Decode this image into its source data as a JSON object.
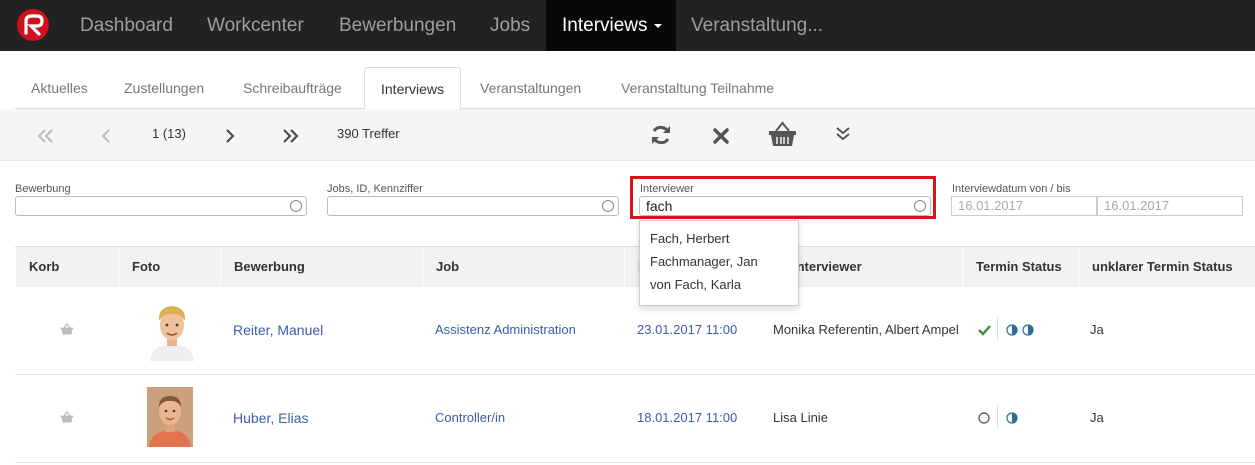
{
  "navbar": {
    "items": [
      "Dashboard",
      "Workcenter",
      "Bewerbungen",
      "Jobs",
      "Interviews",
      "Veranstaltung..."
    ],
    "active": "Interviews"
  },
  "tabs": [
    "Aktuelles",
    "Zustellungen",
    "Schreibaufträge",
    "Interviews",
    "Veranstaltungen",
    "Veranstaltung Teilnahme"
  ],
  "toolbar": {
    "page": "1 (13)",
    "hits": "390 Treffer"
  },
  "filters": {
    "bewerbung_label": "Bewerbung",
    "bewerbung_value": "",
    "jobs_label": "Jobs, ID, Kennziffer",
    "jobs_value": "",
    "interviewer_label": "Interviewer",
    "interviewer_value": "fach",
    "datum_label": "Interviewdatum von / bis",
    "datum_from_placeholder": "16.01.2017",
    "datum_to_placeholder": "16.01.2017"
  },
  "dropdown": [
    "Fach, Herbert",
    "Fachmanager, Jan",
    "von Fach, Karla"
  ],
  "table": {
    "headers": [
      "Korb",
      "Foto",
      "Bewerbung",
      "Job",
      "I",
      "Interviewer",
      "Termin Status",
      "unklarer Termin Status"
    ],
    "rows": [
      {
        "bewerbung": "Reiter, Manuel",
        "job": "Assistenz Administration",
        "datum": "23.01.2017 11:00",
        "interviewer": "Monika Referentin, Albert Ampel",
        "unklar": "Ja"
      },
      {
        "bewerbung": "Huber, Elias",
        "job": "Controller/in",
        "datum": "18.01.2017 11:00",
        "interviewer": "Lisa Linie",
        "unklar": "Ja"
      }
    ]
  },
  "colors": {
    "accent": "#d9121b",
    "link": "#3b5ea8",
    "check": "#3c8d3c",
    "half_circle": "#2a6f97"
  }
}
